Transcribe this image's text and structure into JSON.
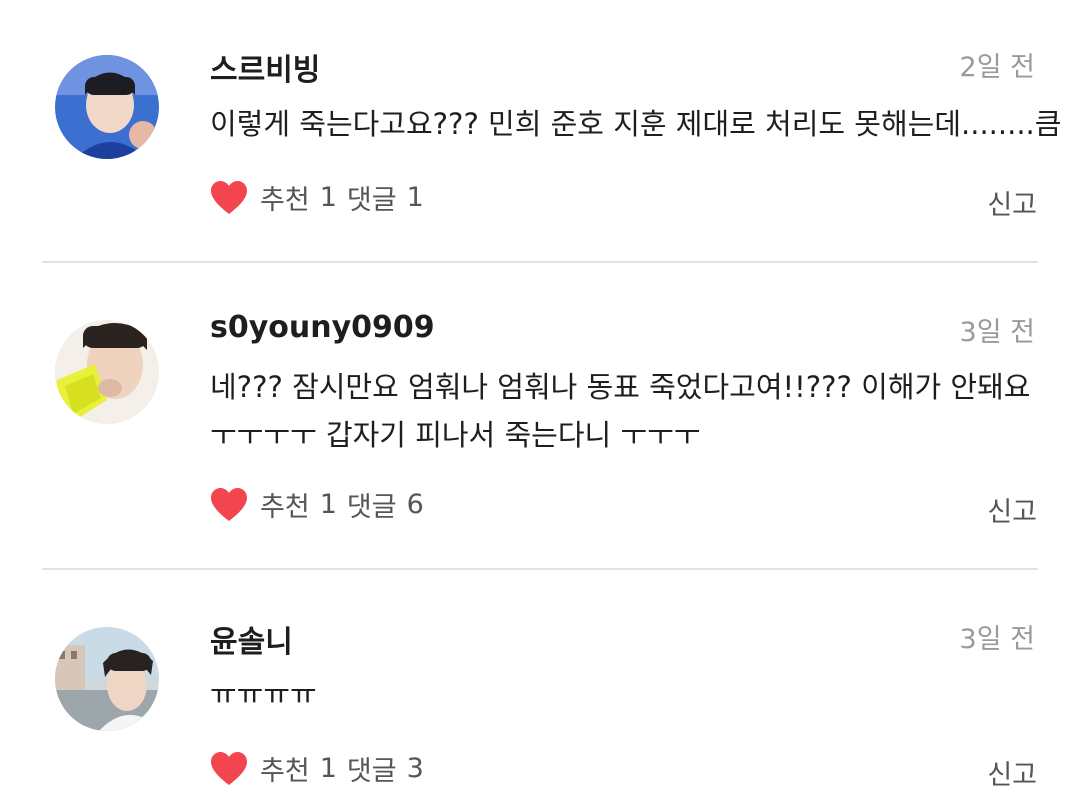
{
  "comments": [
    {
      "username": "스르비빙",
      "time": "2일 전",
      "lines": [
        "이렇게 죽는다고요??? 민희 준호 지훈 제대로 처리도 못해는데........큼"
      ],
      "like_label": "추천",
      "like_count": "1",
      "reply_label": "댓글",
      "reply_count": "1",
      "report_label": "신고",
      "avatar_icon": "user-avatar-photo"
    },
    {
      "username": "s0youny0909",
      "time": "3일 전",
      "lines": [
        "네??? 잠시만요 엄훠나 엄훠나 동표 죽었다고여!!??? 이해가 안돼요",
        "ㅜㅜㅜㅜ 갑자기 피나서 죽는다니 ㅜㅜㅜ"
      ],
      "like_label": "추천",
      "like_count": "1",
      "reply_label": "댓글",
      "reply_count": "6",
      "report_label": "신고",
      "avatar_icon": "user-avatar-photo"
    },
    {
      "username": "윤솔니",
      "time": "3일 전",
      "lines": [
        "ㅠㅠㅠㅠ"
      ],
      "like_label": "추천",
      "like_count": "1",
      "reply_label": "댓글",
      "reply_count": "3",
      "report_label": "신고",
      "avatar_icon": "user-avatar-photo"
    }
  ],
  "colors": {
    "heart": "#f2454f",
    "divider": "#e2e2e2",
    "time": "#9a9a9a",
    "meta": "#555555"
  }
}
